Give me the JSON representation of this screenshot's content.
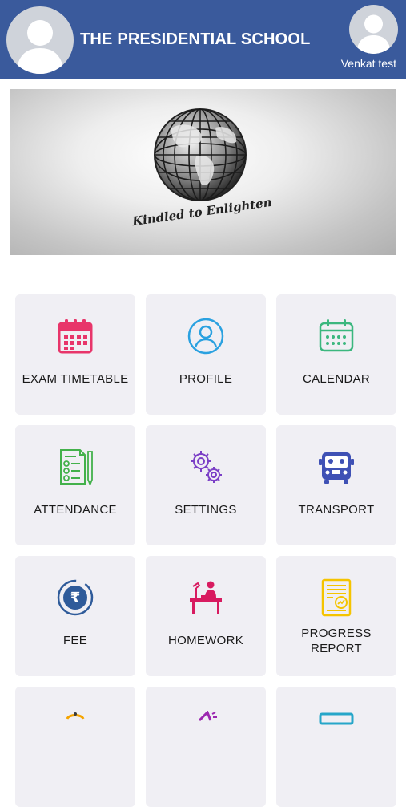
{
  "header": {
    "title": "THE PRESIDENTIAL SCHOOL",
    "user_name": "Venkat test",
    "avatar_icon": "user-avatar-icon"
  },
  "banner": {
    "motto": "Kindled to Enlighten",
    "image": "globe-logo"
  },
  "tiles": [
    {
      "label": "EXAM TIMETABLE",
      "icon": "calendar-grid-icon",
      "color": "#e8356a"
    },
    {
      "label": "PROFILE",
      "icon": "user-circle-icon",
      "color": "#2aa1e0"
    },
    {
      "label": "CALENDAR",
      "icon": "calendar-icon",
      "color": "#3bb77e"
    },
    {
      "label": "ATTENDANCE",
      "icon": "checklist-icon",
      "color": "#43b14b"
    },
    {
      "label": "SETTINGS",
      "icon": "gears-icon",
      "color": "#7b3fc6"
    },
    {
      "label": "TRANSPORT",
      "icon": "bus-icon",
      "color": "#3f51b5"
    },
    {
      "label": "FEE",
      "icon": "rupee-coin-icon",
      "color": "#2f5b9a"
    },
    {
      "label": "HOMEWORK",
      "icon": "desk-study-icon",
      "color": "#d81b60"
    },
    {
      "label": "PROGRESS REPORT",
      "icon": "report-icon",
      "color": "#f5c400"
    }
  ],
  "colors": {
    "header_bg": "#3a5a9c",
    "tile_bg": "#f0eff4"
  }
}
